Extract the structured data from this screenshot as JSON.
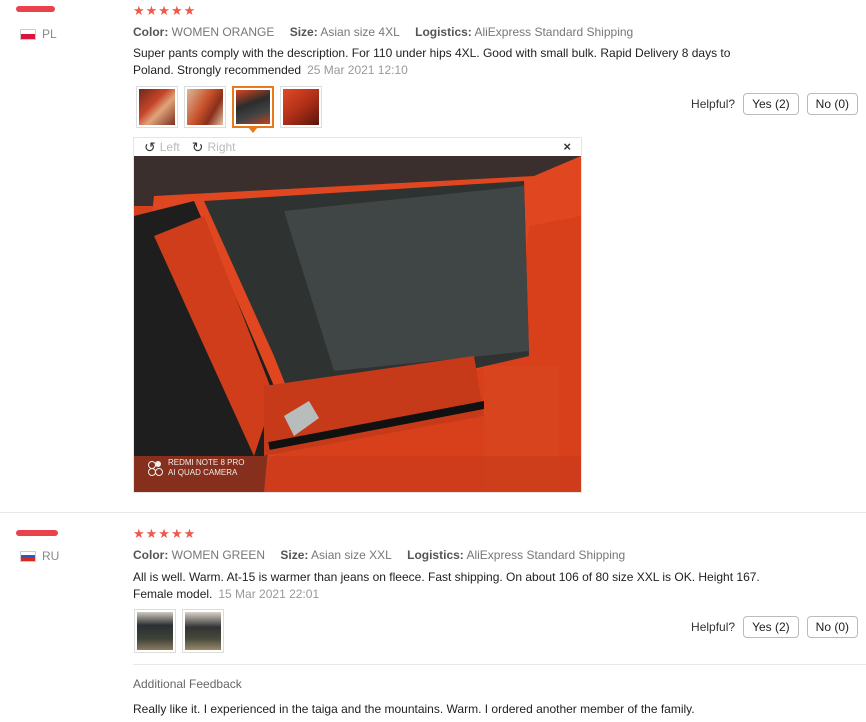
{
  "reviews": [
    {
      "country": "PL",
      "stars": "★★★★★",
      "color_label": "Color:",
      "color_value": "WOMEN ORANGE",
      "size_label": "Size:",
      "size_value": "Asian size 4XL",
      "logistics_label": "Logistics:",
      "logistics_value": "AliExpress Standard Shipping",
      "text_line1": "Super pants comply with the description. For 110 under hips 4XL. Good with small bulk. Rapid Delivery 8 days to",
      "text_line2": "Poland. Strongly recommended",
      "date": "25 Mar 2021 12:10",
      "helpful_label": "Helpful?",
      "yes_label": "Yes (2)",
      "no_label": "No (0)"
    },
    {
      "country": "RU",
      "stars": "★★★★★",
      "color_label": "Color:",
      "color_value": "WOMEN GREEN",
      "size_label": "Size:",
      "size_value": "Asian size XXL",
      "logistics_label": "Logistics:",
      "logistics_value": "AliExpress Standard Shipping",
      "text_line1": "All is well. Warm. At-15 is warmer than jeans on fleece. Fast shipping. On about 106 of 80 size XXL is OK. Height 167.",
      "text_line2": "Female model.",
      "date": "15 Mar 2021 22:01",
      "helpful_label": "Helpful?",
      "yes_label": "Yes (2)",
      "no_label": "No (0)",
      "additional_feedback_title": "Additional Feedback",
      "additional_feedback_text": "Really like it. I experienced in the taiga and the mountains. Warm. I ordered another member of the family."
    }
  ],
  "viewer": {
    "rotate_left_label": "Left",
    "rotate_right_label": "Right",
    "close_glyph": "×",
    "rotate_left_glyph": "↺",
    "rotate_right_glyph": "↻",
    "watermark_line1": "REDMI NOTE 8 PRO",
    "watermark_line2": "AI QUAD CAMERA"
  },
  "colors": {
    "accent_red": "#e8424b",
    "star_red": "#f1574a",
    "active_thumb_border": "#e87a1a"
  }
}
